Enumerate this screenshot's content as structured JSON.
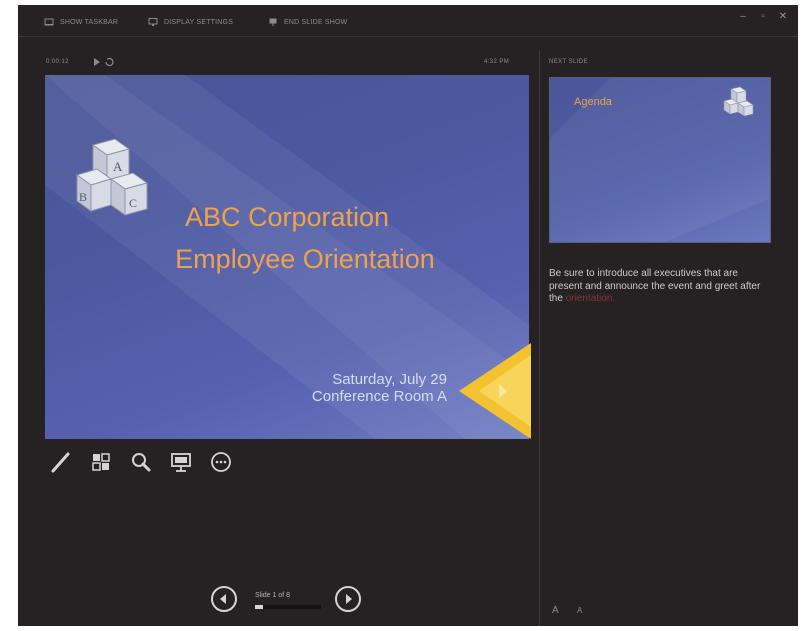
{
  "toolbar": {
    "items": [
      {
        "label": "SHOW TASKBAR",
        "icon": "taskbar-icon"
      },
      {
        "label": "DISPLAY SETTINGS",
        "icon": "display-settings-icon"
      },
      {
        "label": "END SLIDE SHOW",
        "icon": "end-show-icon"
      }
    ],
    "window_controls": [
      "–",
      "▫",
      "✕"
    ]
  },
  "presenter": {
    "timer": "0:00:12",
    "clock": "4:32 PM"
  },
  "slide": {
    "title_line1": "ABC Corporation",
    "title_line2": "Employee Orientation",
    "subtitle_line1": "Saturday, July 29",
    "subtitle_line2": "Conference Room A"
  },
  "tools": [
    "pen-icon",
    "slides-grid-icon",
    "zoom-icon",
    "screen-icon",
    "more-icon"
  ],
  "navigation": {
    "slide_count": "Slide 1 of 8",
    "progress_fraction": 0.125
  },
  "next_slide": {
    "label": "NEXT SLIDE",
    "title": "Agenda"
  },
  "notes": {
    "text": "Be sure to introduce all executives that are present and announce the event and greet after the",
    "faint_text": "orientation."
  },
  "colors": {
    "background": "#262223",
    "slide_accent": "#f0a24a",
    "slide_blue": "#5561ae",
    "next_arrow": "#f2c230"
  }
}
